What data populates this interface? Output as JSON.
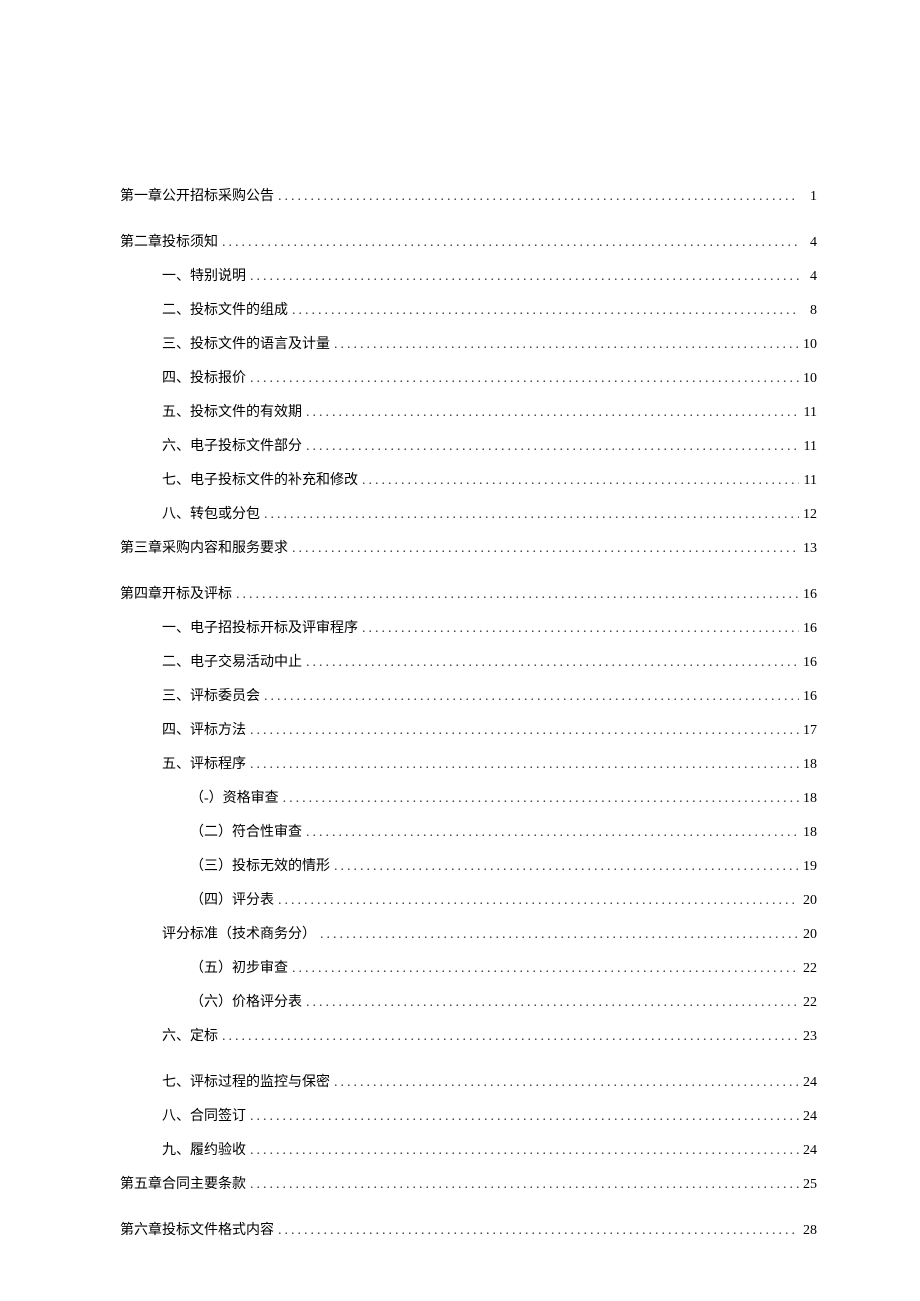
{
  "toc": [
    {
      "lvl": 0,
      "title": "第一章公开招标采购公告",
      "page": "1",
      "spacer": false
    },
    {
      "lvl": 0,
      "title": "第二章投标须知",
      "page": "4",
      "spacer": true
    },
    {
      "lvl": 1,
      "title": "一、特别说明",
      "page": "4",
      "spacer": false
    },
    {
      "lvl": 1,
      "title": "二、投标文件的组成",
      "page": "8",
      "spacer": false
    },
    {
      "lvl": 1,
      "title": "三、投标文件的语言及计量",
      "page": "10",
      "spacer": false
    },
    {
      "lvl": 1,
      "title": "四、投标报价",
      "page": "10",
      "spacer": false
    },
    {
      "lvl": 1,
      "title": "五、投标文件的有效期",
      "page": "11",
      "spacer": false
    },
    {
      "lvl": 1,
      "title": "六、电子投标文件部分",
      "page": "11",
      "spacer": false
    },
    {
      "lvl": 1,
      "title": "七、电子投标文件的补充和修改",
      "page": "11",
      "spacer": false
    },
    {
      "lvl": 1,
      "title": "八、转包或分包",
      "page": "12",
      "spacer": false
    },
    {
      "lvl": 0,
      "title": "第三章采购内容和服务要求",
      "page": "13",
      "spacer": false
    },
    {
      "lvl": 0,
      "title": "第四章开标及评标",
      "page": "16",
      "spacer": true
    },
    {
      "lvl": 1,
      "title": "一、电子招投标开标及评审程序",
      "page": "16",
      "spacer": false
    },
    {
      "lvl": 1,
      "title": "二、电子交易活动中止",
      "page": "16",
      "spacer": false
    },
    {
      "lvl": 1,
      "title": "三、评标委员会",
      "page": "16",
      "spacer": false
    },
    {
      "lvl": 1,
      "title": "四、评标方法",
      "page": "17",
      "spacer": false
    },
    {
      "lvl": 1,
      "title": "五、评标程序",
      "page": "18",
      "spacer": false
    },
    {
      "lvl": 2,
      "title": "（-）资格审查",
      "page": "18",
      "spacer": false
    },
    {
      "lvl": 2,
      "title": "（二）符合性审查",
      "page": "18",
      "spacer": false
    },
    {
      "lvl": 2,
      "title": "（三）投标无效的情形",
      "page": "19",
      "spacer": false
    },
    {
      "lvl": 2,
      "title": "（四）评分表",
      "page": "20",
      "spacer": false
    },
    {
      "lvl": 1,
      "title": "评分标准（技术商务分）",
      "page": "20",
      "spacer": false
    },
    {
      "lvl": 2,
      "title": "（五）初步审查",
      "page": "22",
      "spacer": false
    },
    {
      "lvl": 2,
      "title": "（六）价格评分表",
      "page": "22",
      "spacer": false
    },
    {
      "lvl": 1,
      "title": "六、定标",
      "page": "23",
      "spacer": false
    },
    {
      "lvl": 1,
      "title": "七、评标过程的监控与保密",
      "page": "24",
      "spacer": true
    },
    {
      "lvl": 1,
      "title": "八、合同签订",
      "page": "24",
      "spacer": false
    },
    {
      "lvl": 1,
      "title": "九、履约验收",
      "page": "24",
      "spacer": false
    },
    {
      "lvl": 0,
      "title": "第五章合同主要条款",
      "page": "25",
      "spacer": false
    },
    {
      "lvl": 0,
      "title": "第六章投标文件格式内容",
      "page": "28",
      "spacer": true
    }
  ]
}
